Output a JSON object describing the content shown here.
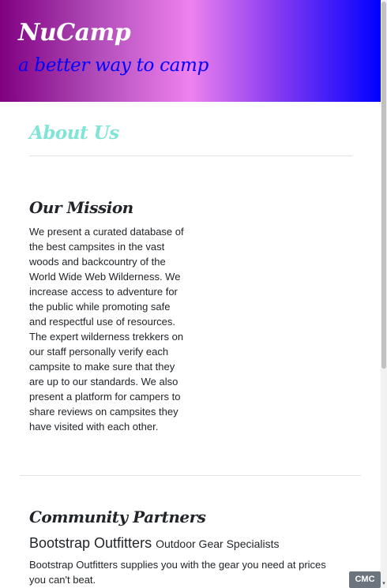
{
  "header": {
    "brand": "NuCamp",
    "tagline": "a better way to camp"
  },
  "about": {
    "title": "About Us"
  },
  "mission": {
    "title": "Our Mission",
    "text": "We present a curated database of the best campsites in the vast woods and backcountry of the World Wide Web Wilderness. We increase access to adventure for the public while promoting safe and respectful use of resources. The expert wilderness trekkers on our staff personally verify each campsite to make sure that they are up to our standards. We also present a platform for campers to share reviews on campsites they have visited with each other."
  },
  "partners": {
    "title": "Community Partners",
    "items": [
      {
        "name": "Bootstrap Outfitters",
        "subtitle": "Outdoor Gear Specialists",
        "description": "Bootstrap Outfitters supplies you with the gear you need at prices you can't beat."
      }
    ]
  },
  "badge": {
    "label": "CMC"
  },
  "colors": {
    "brand_text": "#ffffff",
    "tagline": "#0000ff",
    "about_title": "#7fe5d6",
    "gradient": [
      "#800080",
      "#ee82ee",
      "#0000ff"
    ]
  }
}
